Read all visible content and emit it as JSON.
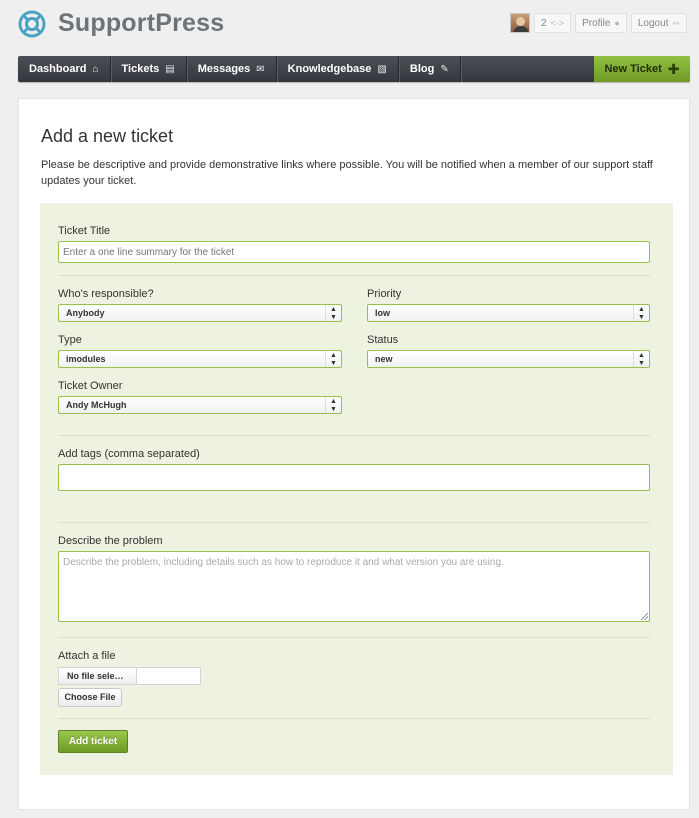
{
  "app": {
    "name": "SupportPress",
    "brand_color": "#4aa3c5"
  },
  "userbar": {
    "message_count": "2",
    "message_icon": "eye-icon",
    "profile_label": "Profile",
    "profile_icon": "person-icon",
    "logout_label": "Logout",
    "logout_icon": "exit-icon"
  },
  "nav": {
    "items": [
      {
        "label": "Dashboard",
        "icon": "home-icon"
      },
      {
        "label": "Tickets",
        "icon": "ticket-icon"
      },
      {
        "label": "Messages",
        "icon": "envelope-icon"
      },
      {
        "label": "Knowledgebase",
        "icon": "book-icon"
      },
      {
        "label": "Blog",
        "icon": "pencil-icon"
      }
    ],
    "new_ticket_label": "New Ticket",
    "new_ticket_color": "#85b236"
  },
  "page": {
    "title": "Add a new ticket",
    "intro": "Please be descriptive and provide demonstrative links where possible. You will be notified when a member of our support staff updates your ticket."
  },
  "form": {
    "ticket_title": {
      "label": "Ticket Title",
      "placeholder": "Enter a one line summary for the ticket"
    },
    "responsible": {
      "label": "Who's responsible?",
      "value": "Anybody"
    },
    "priority": {
      "label": "Priority",
      "value": "low"
    },
    "type": {
      "label": "Type",
      "value": "imodules"
    },
    "status": {
      "label": "Status",
      "value": "new"
    },
    "owner": {
      "label": "Ticket Owner",
      "value": "Andy McHugh"
    },
    "tags": {
      "label": "Add tags (comma separated)",
      "value": ""
    },
    "problem": {
      "label": "Describe the problem",
      "placeholder": "Describe the problem, including details such as how to reproduce it and what version you are using."
    },
    "attach": {
      "label": "Attach a file",
      "file_status": "No file sele…",
      "choose_label": "Choose File"
    },
    "submit_label": "Add ticket"
  }
}
